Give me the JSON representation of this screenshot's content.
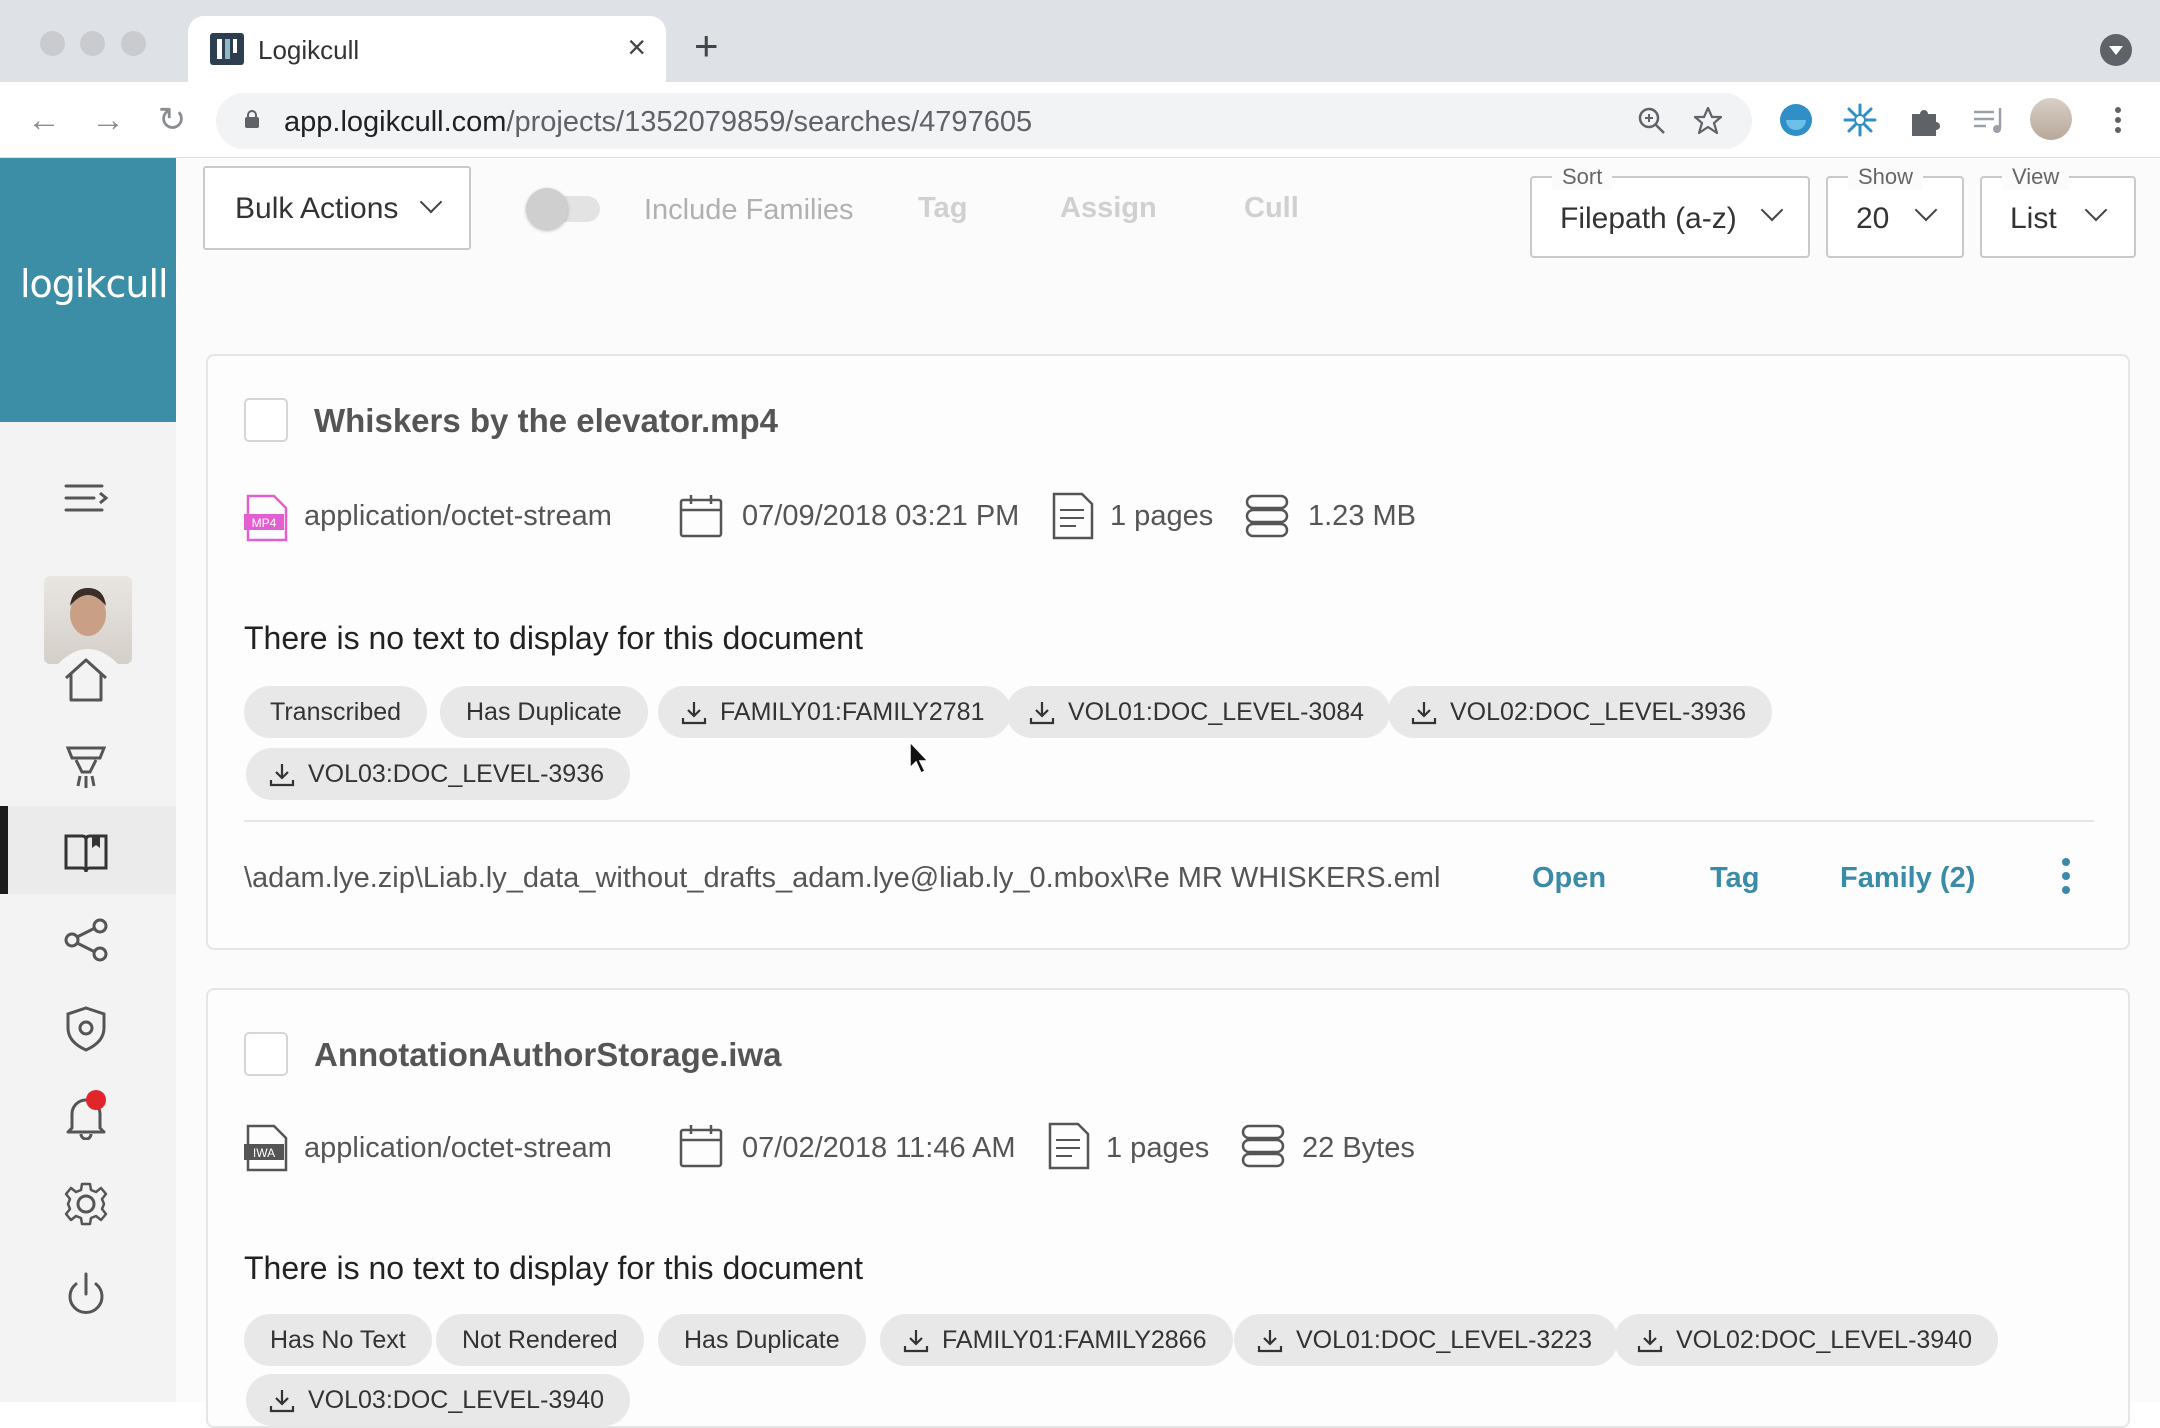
{
  "browser": {
    "tab_title": "Logikcull",
    "url_host": "app.logikcull.com",
    "url_path": "/projects/1352079859/searches/4797605"
  },
  "sidebar": {
    "logo": "logikcull"
  },
  "toolbar": {
    "bulk_actions": "Bulk Actions",
    "include_families": "Include Families",
    "tag": "Tag",
    "assign": "Assign",
    "cull": "Cull",
    "sort": {
      "label": "Sort",
      "value": "Filepath (a-z)"
    },
    "show": {
      "label": "Show",
      "value": "20"
    },
    "view": {
      "label": "View",
      "value": "List"
    }
  },
  "documents": [
    {
      "title": "Whiskers by the elevator.mp4",
      "file_badge": "MP4",
      "mime": "application/octet-stream",
      "date": "07/09/2018 03:21 PM",
      "pages": "1 pages",
      "size": "1.23 MB",
      "text": "There is no text to display for this document",
      "chips": [
        "Transcribed",
        "Has Duplicate",
        "FAMILY01:FAMILY2781",
        "VOL01:DOC_LEVEL-3084",
        "VOL02:DOC_LEVEL-3936",
        "VOL03:DOC_LEVEL-3936"
      ],
      "filepath": "\\adam.lye.zip\\Liab.ly_data_without_drafts_adam.lye@liab.ly_0.mbox\\Re  MR WHISKERS.eml",
      "actions": {
        "open": "Open",
        "tag": "Tag",
        "family": "Family (2)"
      }
    },
    {
      "title": "AnnotationAuthorStorage.iwa",
      "file_badge": "IWA",
      "mime": "application/octet-stream",
      "date": "07/02/2018 11:46 AM",
      "pages": "1 pages",
      "size": "22 Bytes",
      "text": "There is no text to display for this document",
      "chips": [
        "Has No Text",
        "Not Rendered",
        "Has Duplicate",
        "FAMILY01:FAMILY2866",
        "VOL01:DOC_LEVEL-3223",
        "VOL02:DOC_LEVEL-3940",
        "VOL03:DOC_LEVEL-3940"
      ]
    }
  ]
}
